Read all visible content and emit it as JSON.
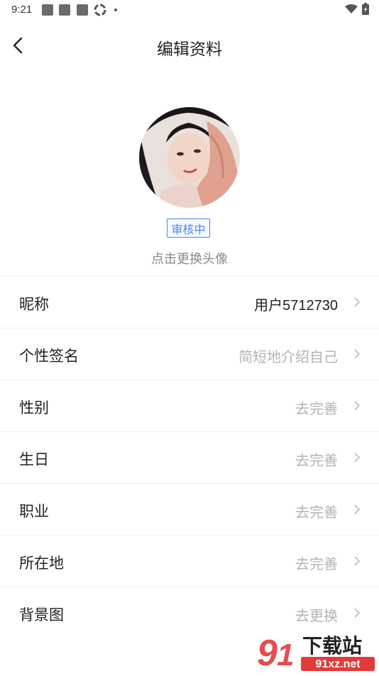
{
  "status_bar": {
    "time": "9:21"
  },
  "header": {
    "title": "编辑资料"
  },
  "avatar": {
    "badge": "审核中",
    "hint": "点击更换头像"
  },
  "rows": [
    {
      "label": "昵称",
      "value": "用户5712730",
      "filled": true
    },
    {
      "label": "个性签名",
      "value": "简短地介绍自己",
      "filled": false
    },
    {
      "label": "性别",
      "value": "去完善",
      "filled": false
    },
    {
      "label": "生日",
      "value": "去完善",
      "filled": false
    },
    {
      "label": "职业",
      "value": "去完善",
      "filled": false
    },
    {
      "label": "所在地",
      "value": "去完善",
      "filled": false
    },
    {
      "label": "背景图",
      "value": "去更换",
      "filled": false
    }
  ],
  "watermark": {
    "brand": "下载站",
    "site": "91xz.net"
  },
  "colors": {
    "accent": "#4a86f7",
    "placeholder": "#b3b3b3",
    "watermark_red": "#e23b3b"
  }
}
